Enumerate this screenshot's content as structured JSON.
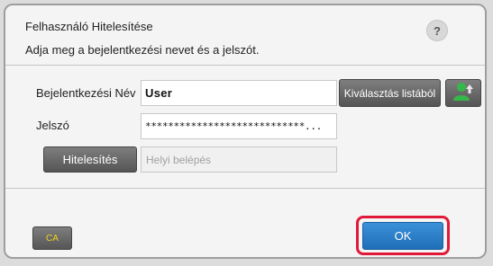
{
  "dialog": {
    "title": "Felhasználó Hitelesítése",
    "help_label": "?",
    "instruction": "Adja meg a bejelentkezési nevet és a jelszót."
  },
  "login_name": {
    "label": "Bejelentkezési Név",
    "value": "User",
    "select_from_list_label": "Kiválasztás listából",
    "user_list_icon": "user-list-icon"
  },
  "password": {
    "label": "Jelszó",
    "value": "****************************..."
  },
  "auth": {
    "button_label": "Hitelesítés",
    "destination_placeholder": "Helyi belépés"
  },
  "footer": {
    "ca_label": "CA",
    "ok_label": "OK"
  },
  "colors": {
    "ok_blue": "#2a7fc8",
    "highlight_red": "#e0193a",
    "ca_text": "#f2d21b",
    "user_icon_green": "#35b84a"
  }
}
